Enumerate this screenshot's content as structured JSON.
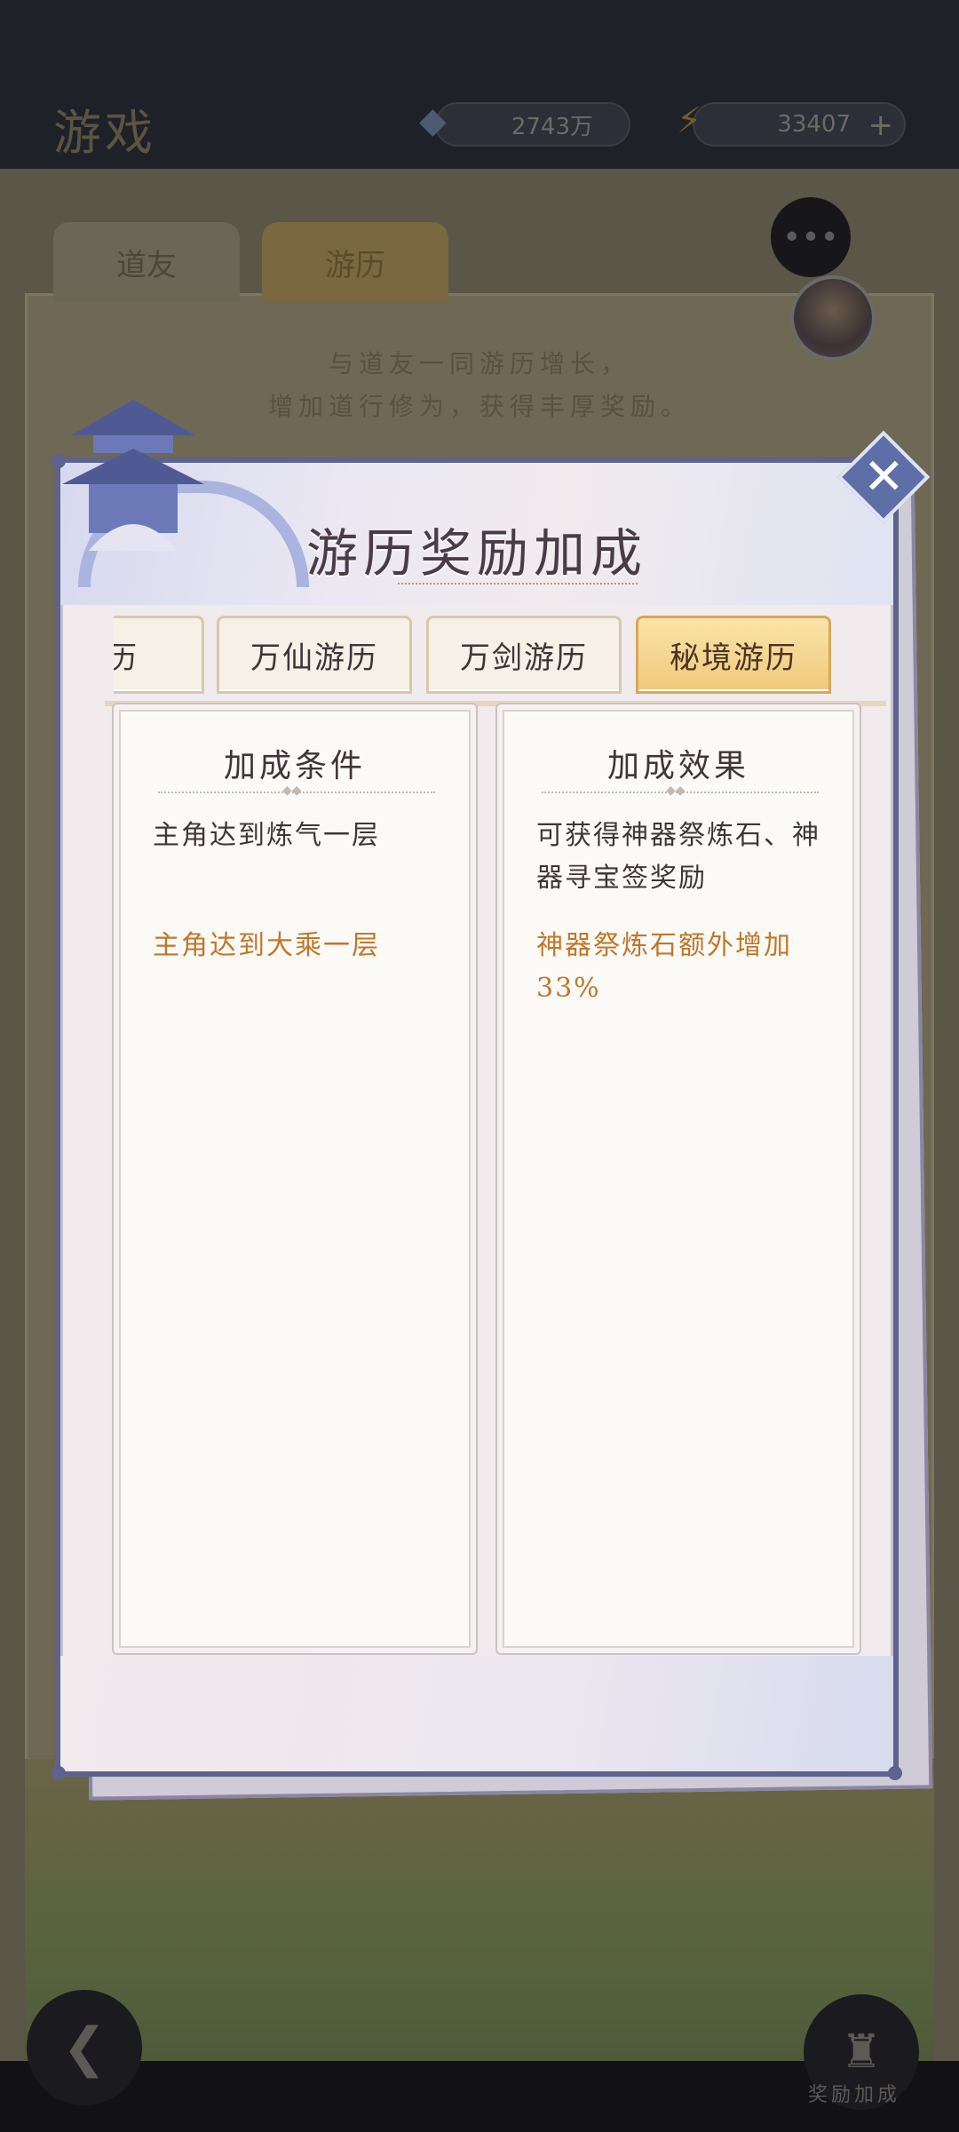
{
  "background": {
    "title": "游戏",
    "resource_1": "2743万",
    "resource_2": "33407",
    "tabs": [
      "道友",
      "游历"
    ],
    "intro_line_1": "与道友一同游历增长，",
    "intro_line_2": "增加道行修为，获得丰厚奖励。",
    "bottom_right_label": "奖励加成"
  },
  "modal": {
    "title": "游历奖励加成",
    "close_label": "✕",
    "tabs": [
      {
        "label": "游历",
        "active": false
      },
      {
        "label": "万仙游历",
        "active": false
      },
      {
        "label": "万剑游历",
        "active": false
      },
      {
        "label": "秘境游历",
        "active": true
      }
    ],
    "conditions": {
      "header": "加成条件",
      "items": [
        {
          "text": "主角达到炼气一层",
          "highlight": false
        },
        {
          "text": "主角达到大乘一层",
          "highlight": true
        }
      ]
    },
    "effects": {
      "header": "加成效果",
      "items": [
        {
          "text": "可获得神器祭炼石、神器寻宝签奖励",
          "highlight": false
        },
        {
          "text": "神器祭炼石额外增加33%",
          "highlight": true
        }
      ]
    }
  },
  "colors": {
    "accent_gold": "#f0c97b",
    "highlight_text": "#c0772a",
    "frame_blue": "#5d628e"
  }
}
